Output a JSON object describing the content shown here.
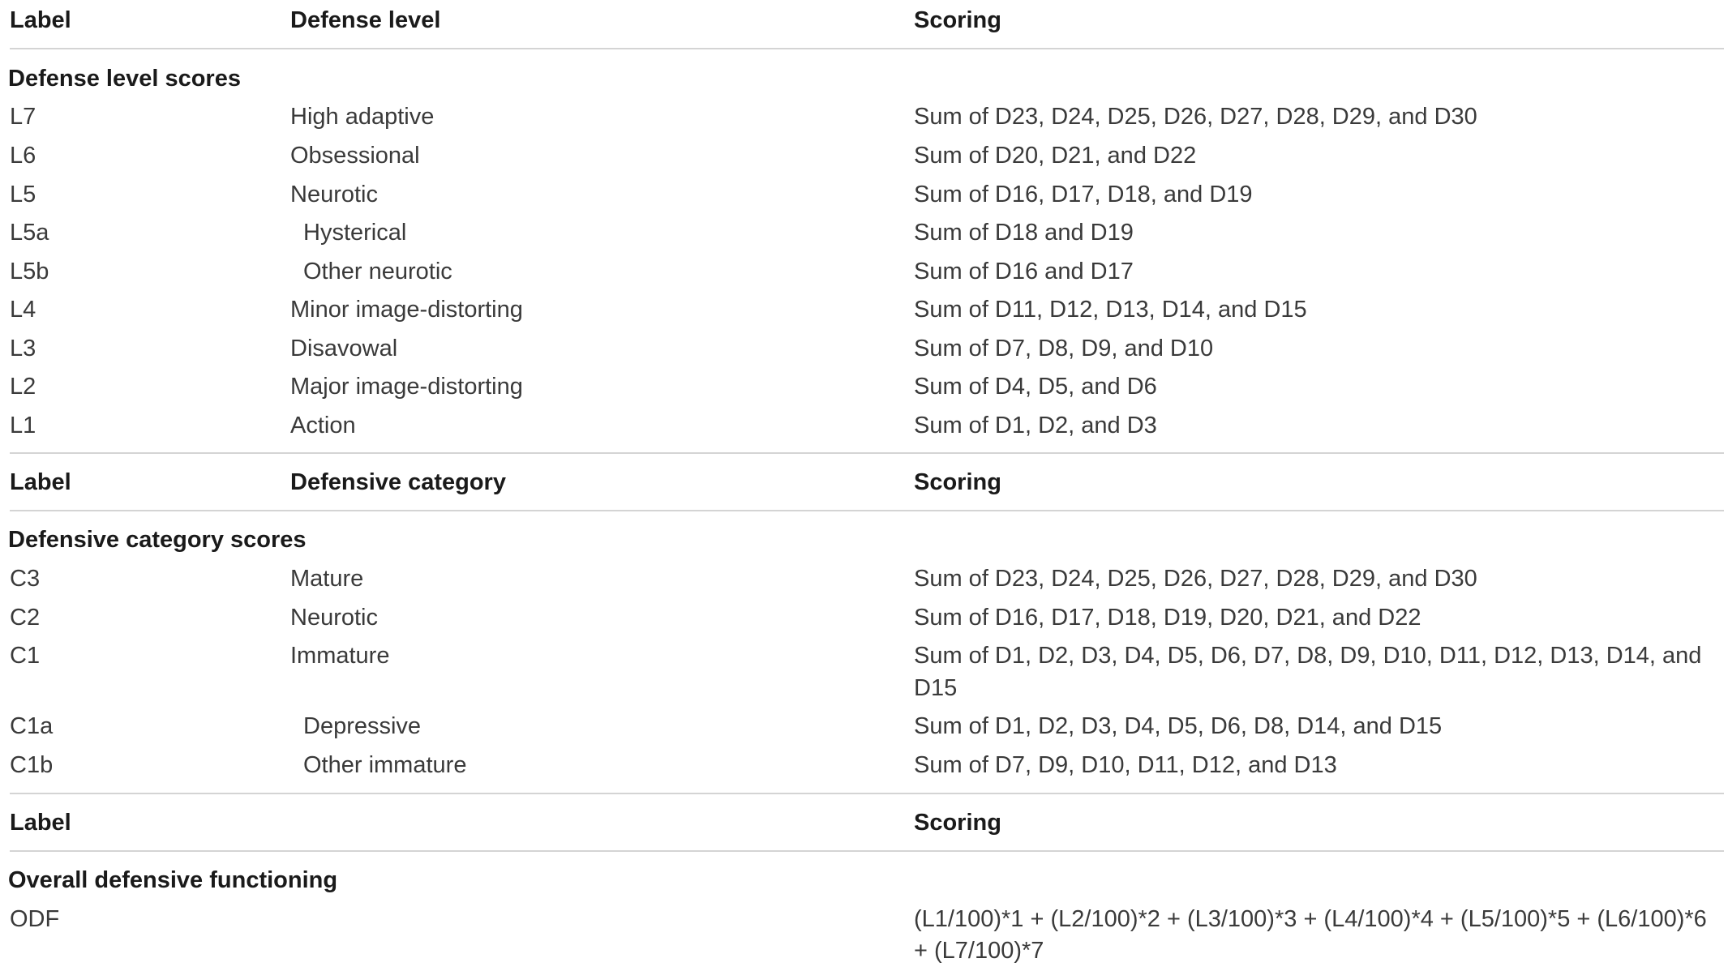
{
  "table1": {
    "headers": {
      "label": "Label",
      "col2": "Defense level",
      "scoring": "Scoring"
    },
    "section": "Defense level scores",
    "rows": [
      {
        "label": "L7",
        "name": "High adaptive",
        "scoring": "Sum of D23, D24, D25, D26, D27, D28, D29, and D30",
        "indent": false
      },
      {
        "label": "L6",
        "name": "Obsessional",
        "scoring": "Sum of D20, D21, and D22",
        "indent": false
      },
      {
        "label": "L5",
        "name": "Neurotic",
        "scoring": "Sum of D16, D17, D18, and D19",
        "indent": false
      },
      {
        "label": "L5a",
        "name": "Hysterical",
        "scoring": "Sum of D18 and D19",
        "indent": true
      },
      {
        "label": "L5b",
        "name": "Other neurotic",
        "scoring": "Sum of D16 and D17",
        "indent": true
      },
      {
        "label": "L4",
        "name": "Minor image-distorting",
        "scoring": "Sum of D11, D12, D13, D14, and D15",
        "indent": false
      },
      {
        "label": "L3",
        "name": "Disavowal",
        "scoring": "Sum of D7, D8, D9, and D10",
        "indent": false
      },
      {
        "label": "L2",
        "name": "Major image-distorting",
        "scoring": "Sum of D4, D5, and D6",
        "indent": false
      },
      {
        "label": "L1",
        "name": "Action",
        "scoring": "Sum of D1, D2, and D3",
        "indent": false
      }
    ]
  },
  "table2": {
    "headers": {
      "label": "Label",
      "col2": "Defensive category",
      "scoring": "Scoring"
    },
    "section": "Defensive category scores",
    "rows": [
      {
        "label": "C3",
        "name": "Mature",
        "scoring": "Sum of D23, D24, D25, D26, D27, D28, D29, and D30",
        "indent": false
      },
      {
        "label": "C2",
        "name": "Neurotic",
        "scoring": "Sum of D16, D17, D18, D19, D20, D21, and D22",
        "indent": false
      },
      {
        "label": "C1",
        "name": "Immature",
        "scoring_lines": [
          "Sum of D1, D2, D3, D4, D5, D6, D7, D8, D9, D10, D11, D12, D13, D14, and",
          "D15"
        ],
        "indent": false
      },
      {
        "label": "C1a",
        "name": "Depressive",
        "scoring": "Sum of D1, D2, D3, D4, D5, D6, D8, D14, and D15",
        "indent": true
      },
      {
        "label": "C1b",
        "name": "Other immature",
        "scoring": "Sum of D7, D9, D10, D11, D12, and D13",
        "indent": true
      }
    ]
  },
  "table3": {
    "headers": {
      "label": "Label",
      "scoring": "Scoring"
    },
    "section": "Overall defensive functioning",
    "rows": [
      {
        "label": "ODF",
        "scoring_lines": [
          "(L1/100)*1 + (L2/100)*2 + (L3/100)*3 + (L4/100)*4 + (L5/100)*5 + (L6/100)*6",
          "+ (L7/100)*7"
        ]
      }
    ]
  }
}
